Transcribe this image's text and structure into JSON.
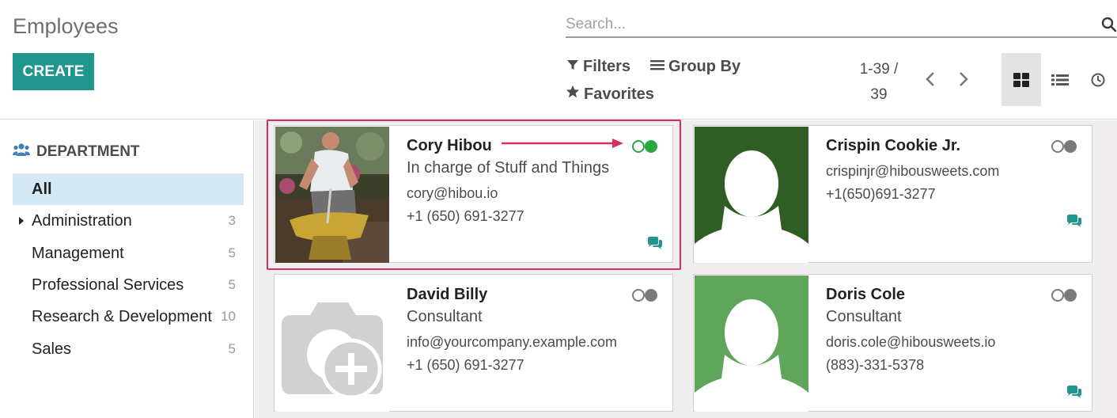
{
  "app": {
    "title": "Employees",
    "create_label": "CREATE"
  },
  "search": {
    "placeholder": "Search..."
  },
  "filters": {
    "filters_label": "Filters",
    "group_by_label": "Group By",
    "favorites_label": "Favorites"
  },
  "pager": {
    "range": "1-39 /",
    "total": "39"
  },
  "views": [
    "kanban-view",
    "list-view",
    "activity-view"
  ],
  "sidebar": {
    "heading": "DEPARTMENT",
    "items": [
      {
        "label": "All",
        "count": "",
        "active": true,
        "expandable": false
      },
      {
        "label": "Administration",
        "count": "3",
        "active": false,
        "expandable": true
      },
      {
        "label": "Management",
        "count": "5",
        "active": false,
        "expandable": false
      },
      {
        "label": "Professional Services",
        "count": "5",
        "active": false,
        "expandable": false
      },
      {
        "label": "Research & Development",
        "count": "10",
        "active": false,
        "expandable": false
      },
      {
        "label": "Sales",
        "count": "5",
        "active": false,
        "expandable": false
      }
    ]
  },
  "employees": [
    {
      "name": "Cory Hibou",
      "job_title": "In charge of Stuff and Things",
      "email": "cory@hibou.io",
      "phone": "+1 (650) 691-3277",
      "presence": "online",
      "photo": "person-photo"
    },
    {
      "name": "Crispin Cookie Jr.",
      "job_title": "",
      "email": "crispinjr@hibousweets.com",
      "phone": "+1(650)691-3277",
      "presence": "offline",
      "photo": "avatar-placeholder"
    },
    {
      "name": "David Billy",
      "job_title": "Consultant",
      "email": "info@yourcompany.example.com",
      "phone": "+1 (650) 691-3277",
      "presence": "offline",
      "photo": "camera-add-icon"
    },
    {
      "name": "Doris Cole",
      "job_title": "Consultant",
      "email": "doris.cole@hibousweets.io",
      "phone": "(883)-331-5378",
      "presence": "offline",
      "photo": "avatar-placeholder"
    }
  ],
  "colors": {
    "accent": "#21968c",
    "highlight": "#d6305c",
    "online": "#28a745",
    "avatar_dark": "#2f5d24",
    "avatar_light": "#5fa65b"
  }
}
